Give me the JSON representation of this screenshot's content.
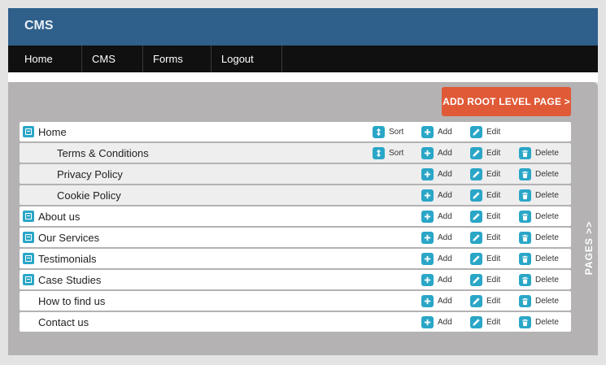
{
  "brand": "CMS",
  "nav": [
    {
      "label": "Home"
    },
    {
      "label": "CMS"
    },
    {
      "label": "Forms"
    },
    {
      "label": "Logout"
    }
  ],
  "add_root_label": "ADD ROOT LEVEL PAGE >",
  "side_tab_label": "PAGES >>",
  "actions": {
    "sort": "Sort",
    "add": "Add",
    "edit": "Edit",
    "delete": "Delete"
  },
  "pages": [
    {
      "title": "Home",
      "level": 0,
      "expandable": true,
      "sort": true,
      "add": true,
      "edit": true,
      "delete": false
    },
    {
      "title": "Terms & Conditions",
      "level": 1,
      "expandable": false,
      "sort": true,
      "add": true,
      "edit": true,
      "delete": true
    },
    {
      "title": "Privacy Policy",
      "level": 1,
      "expandable": false,
      "sort": false,
      "add": true,
      "edit": true,
      "delete": true
    },
    {
      "title": "Cookie Policy",
      "level": 1,
      "expandable": false,
      "sort": false,
      "add": true,
      "edit": true,
      "delete": true
    },
    {
      "title": "About us",
      "level": 0,
      "expandable": true,
      "sort": false,
      "add": true,
      "edit": true,
      "delete": true
    },
    {
      "title": "Our Services",
      "level": 0,
      "expandable": true,
      "sort": false,
      "add": true,
      "edit": true,
      "delete": true
    },
    {
      "title": "Testimonials",
      "level": 0,
      "expandable": true,
      "sort": false,
      "add": true,
      "edit": true,
      "delete": true
    },
    {
      "title": "Case Studies",
      "level": 0,
      "expandable": true,
      "sort": false,
      "add": true,
      "edit": true,
      "delete": true
    },
    {
      "title": "How to find us",
      "level": 0,
      "expandable": false,
      "sort": false,
      "add": true,
      "edit": true,
      "delete": true
    },
    {
      "title": "Contact us",
      "level": 0,
      "expandable": false,
      "sort": false,
      "add": true,
      "edit": true,
      "delete": true
    }
  ],
  "colors": {
    "header": "#2f5f8b",
    "nav": "#101010",
    "accent": "#2aa6c7",
    "button": "#e05a37",
    "panel": "#b4b2b3"
  }
}
